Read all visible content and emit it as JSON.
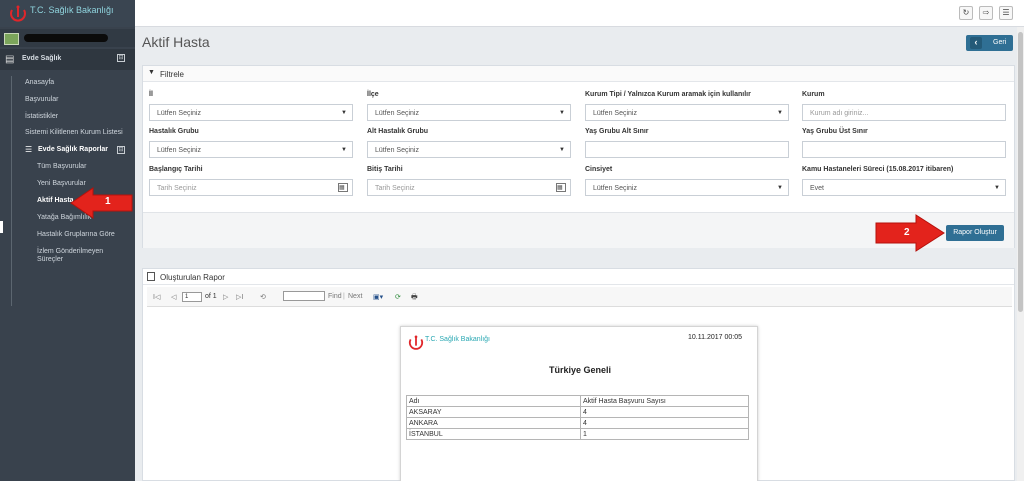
{
  "header": {
    "logo_text": "T.C. Sağlık Bakanlığı",
    "buttons": [
      {
        "label": "↻"
      },
      {
        "label": "⇨"
      },
      {
        "label": "☰"
      }
    ]
  },
  "sidebar": {
    "section_title": "Evde Sağlık",
    "collapse_symbol": "⊟",
    "items": [
      {
        "label": "Anasayfa"
      },
      {
        "label": "Başvurular"
      },
      {
        "label": "İstatistikler"
      },
      {
        "label": "Sistemi Kilitlenen Kurum Listesi"
      }
    ],
    "group": {
      "label": "Evde Sağlık Raporlar",
      "collapse_symbol": "⊟",
      "subitems": [
        {
          "label": "Tüm Başvurular"
        },
        {
          "label": "Yeni Başvurular"
        },
        {
          "label": "Aktif Hasta"
        },
        {
          "label": "Yatağa Bağımlılık"
        },
        {
          "label": "Hastalık Gruplarına Göre"
        },
        {
          "label": "İzlem Gönderilmeyen"
        },
        {
          "label": "Süreçler"
        }
      ]
    }
  },
  "page": {
    "title": "Aktif Hasta",
    "back_label": "Geri",
    "back_symbol": "‹"
  },
  "filter": {
    "title": "Filtrele",
    "fields": [
      {
        "label": "İl",
        "value": "Lütfen Seçiniz"
      },
      {
        "label": "İlçe",
        "value": "Lütfen Seçiniz"
      },
      {
        "label": "Kurum Tipi / Yalnızca Kurum aramak için kullanılır",
        "value": "Lütfen Seçiniz"
      },
      {
        "label": "Kurum",
        "placeholder": "Kurum adı giriniz..."
      },
      {
        "label": "Hastalık Grubu",
        "value": "Lütfen Seçiniz"
      },
      {
        "label": "Alt Hastalık Grubu",
        "value": "Lütfen Seçiniz"
      },
      {
        "label": "Yaş Grubu Alt Sınır",
        "value": ""
      },
      {
        "label": "Yaş Grubu Üst Sınır",
        "value": ""
      },
      {
        "label": "Başlangıç Tarihi",
        "placeholder": "Tarih Seçiniz"
      },
      {
        "label": "Bitiş Tarihi",
        "placeholder": "Tarih Seçiniz"
      },
      {
        "label": "Cinsiyet",
        "value": "Lütfen Seçiniz"
      },
      {
        "label": "Kamu Hastaneleri Süreci (15.08.2017 itibaren)",
        "value": "Evet"
      }
    ],
    "select_arrow": "▼",
    "calendar_symbol": "▦",
    "submit_label": "Rapor Oluştur"
  },
  "report_panel": {
    "title": "Oluşturulan Rapor",
    "toolbar": {
      "first": "I◁",
      "prev": "◁",
      "page_value": "1",
      "of_label": "of 1",
      "next": "▷",
      "last": "▷I",
      "refresh_back": "⟲",
      "find_label": "Find",
      "separator": "|",
      "next_label": "Next",
      "export_symbol": "▣▾",
      "refresh_symbol": "⟳",
      "print_symbol": "🖶"
    },
    "report": {
      "logo_text": "T.C. Sağlık Bakanlığı",
      "date": "10.11.2017 00:05",
      "title": "Türkiye Geneli",
      "columns": [
        "Adı",
        "Aktif Hasta Başvuru Sayısı"
      ],
      "rows": [
        [
          "AKSARAY",
          "4"
        ],
        [
          "ANKARA",
          "4"
        ],
        [
          "İSTANBUL",
          "1"
        ]
      ]
    }
  },
  "annotations": [
    {
      "number": "1",
      "color": "#e3231c"
    },
    {
      "number": "2",
      "color": "#e3231c"
    }
  ]
}
